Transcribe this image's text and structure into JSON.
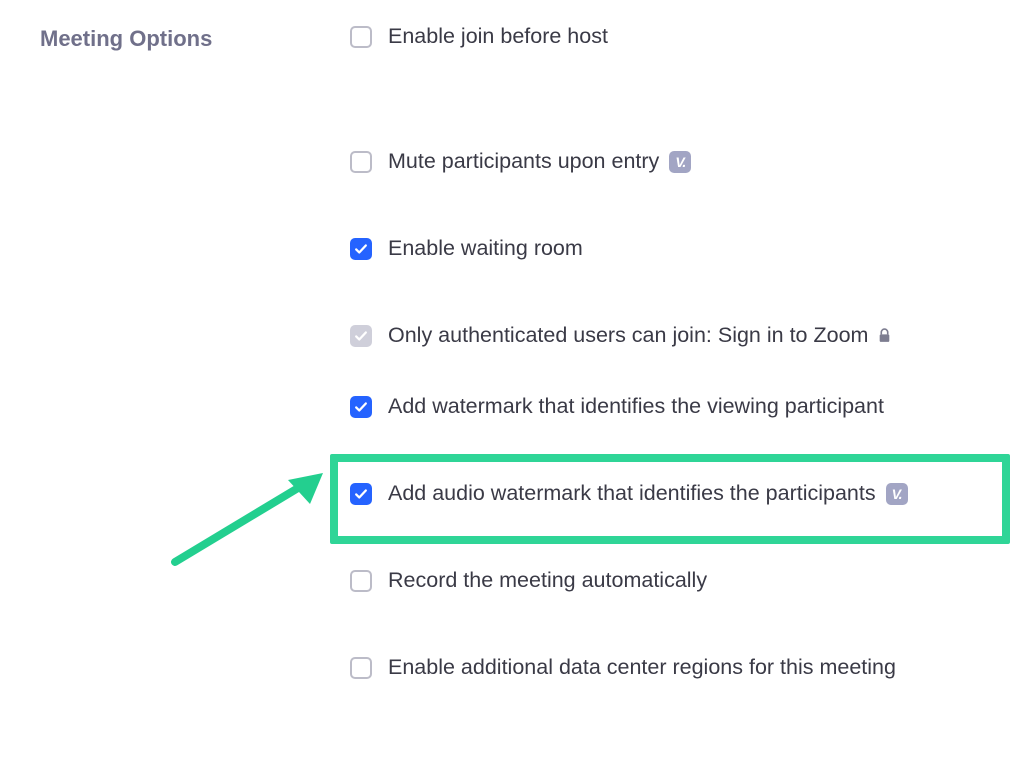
{
  "section_title": "Meeting Options",
  "options": {
    "join_before_host": "Enable join before host",
    "mute_on_entry": "Mute participants upon entry",
    "waiting_room": "Enable waiting room",
    "auth_only": "Only authenticated users can join: Sign in to Zoom",
    "video_watermark": "Add watermark that identifies the viewing participant",
    "audio_watermark": "Add audio watermark that identifies the participants",
    "auto_record": "Record the meeting automatically",
    "data_center": "Enable additional data center regions for this meeting"
  }
}
